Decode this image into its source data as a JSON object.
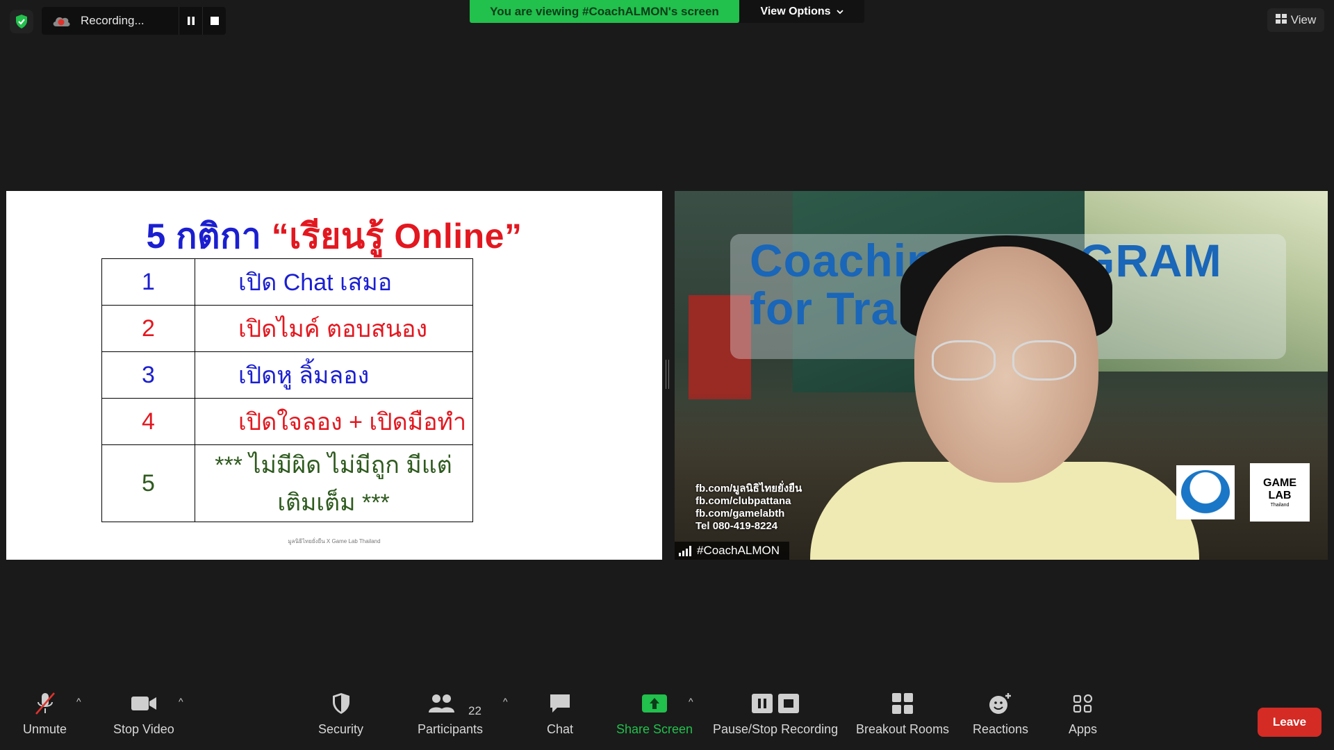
{
  "top_bar": {
    "recording_text": "Recording...",
    "viewing_banner": "You are viewing #CoachALMON's screen",
    "view_options_label": "View Options",
    "view_label": "View"
  },
  "slide": {
    "title_part1": "5 กติกา ",
    "title_part2": "“เรียนรู้ Online”",
    "rules": [
      {
        "num": "1",
        "text": "เปิด Chat เสมอ",
        "color": "#1b1fd0"
      },
      {
        "num": "2",
        "text": "เปิดไมค์ ตอบสนอง",
        "color": "#e3171f"
      },
      {
        "num": "3",
        "text": "เปิดหู ลิ้มลอง",
        "color": "#1b1fd0"
      },
      {
        "num": "4",
        "text": "เปิดใจลอง + เปิดมือทำ",
        "color": "#e3171f"
      },
      {
        "num": "5",
        "text": "*** ไม่มีผิด ไม่มีถูก มีแต่ เติมเต็ม ***",
        "color": "#2e5a1e"
      }
    ],
    "footer": "มูลนิธิไทยยั่งยืน X Game Lab Thailand"
  },
  "camera": {
    "banner_text": "Coaching PROGRAM for Trainer",
    "contacts": [
      "fb.com/มูลนิธิไทยยั่งยืน",
      "fb.com/clubpattana",
      "fb.com/gamelabth",
      "Tel 080-419-8224"
    ],
    "gamelab_logo_line1": "GAME",
    "gamelab_logo_line2": "LAB",
    "gamelab_logo_line3": "Thailand",
    "participant_name": "#CoachALMON"
  },
  "toolbar": {
    "unmute_label": "Unmute",
    "stop_video_label": "Stop Video",
    "security_label": "Security",
    "participants_label": "Participants",
    "participants_count": "22",
    "chat_label": "Chat",
    "share_screen_label": "Share Screen",
    "pause_stop_recording_label": "Pause/Stop Recording",
    "breakout_rooms_label": "Breakout Rooms",
    "reactions_label": "Reactions",
    "apps_label": "Apps",
    "leave_label": "Leave",
    "caret": "^"
  },
  "colors": {
    "background": "#1a1a1a",
    "accent_green": "#22c04c",
    "leave_red": "#d42b25",
    "slide_blue": "#1b1fd0",
    "slide_red": "#e3171f",
    "slide_green": "#2e5a1e"
  }
}
